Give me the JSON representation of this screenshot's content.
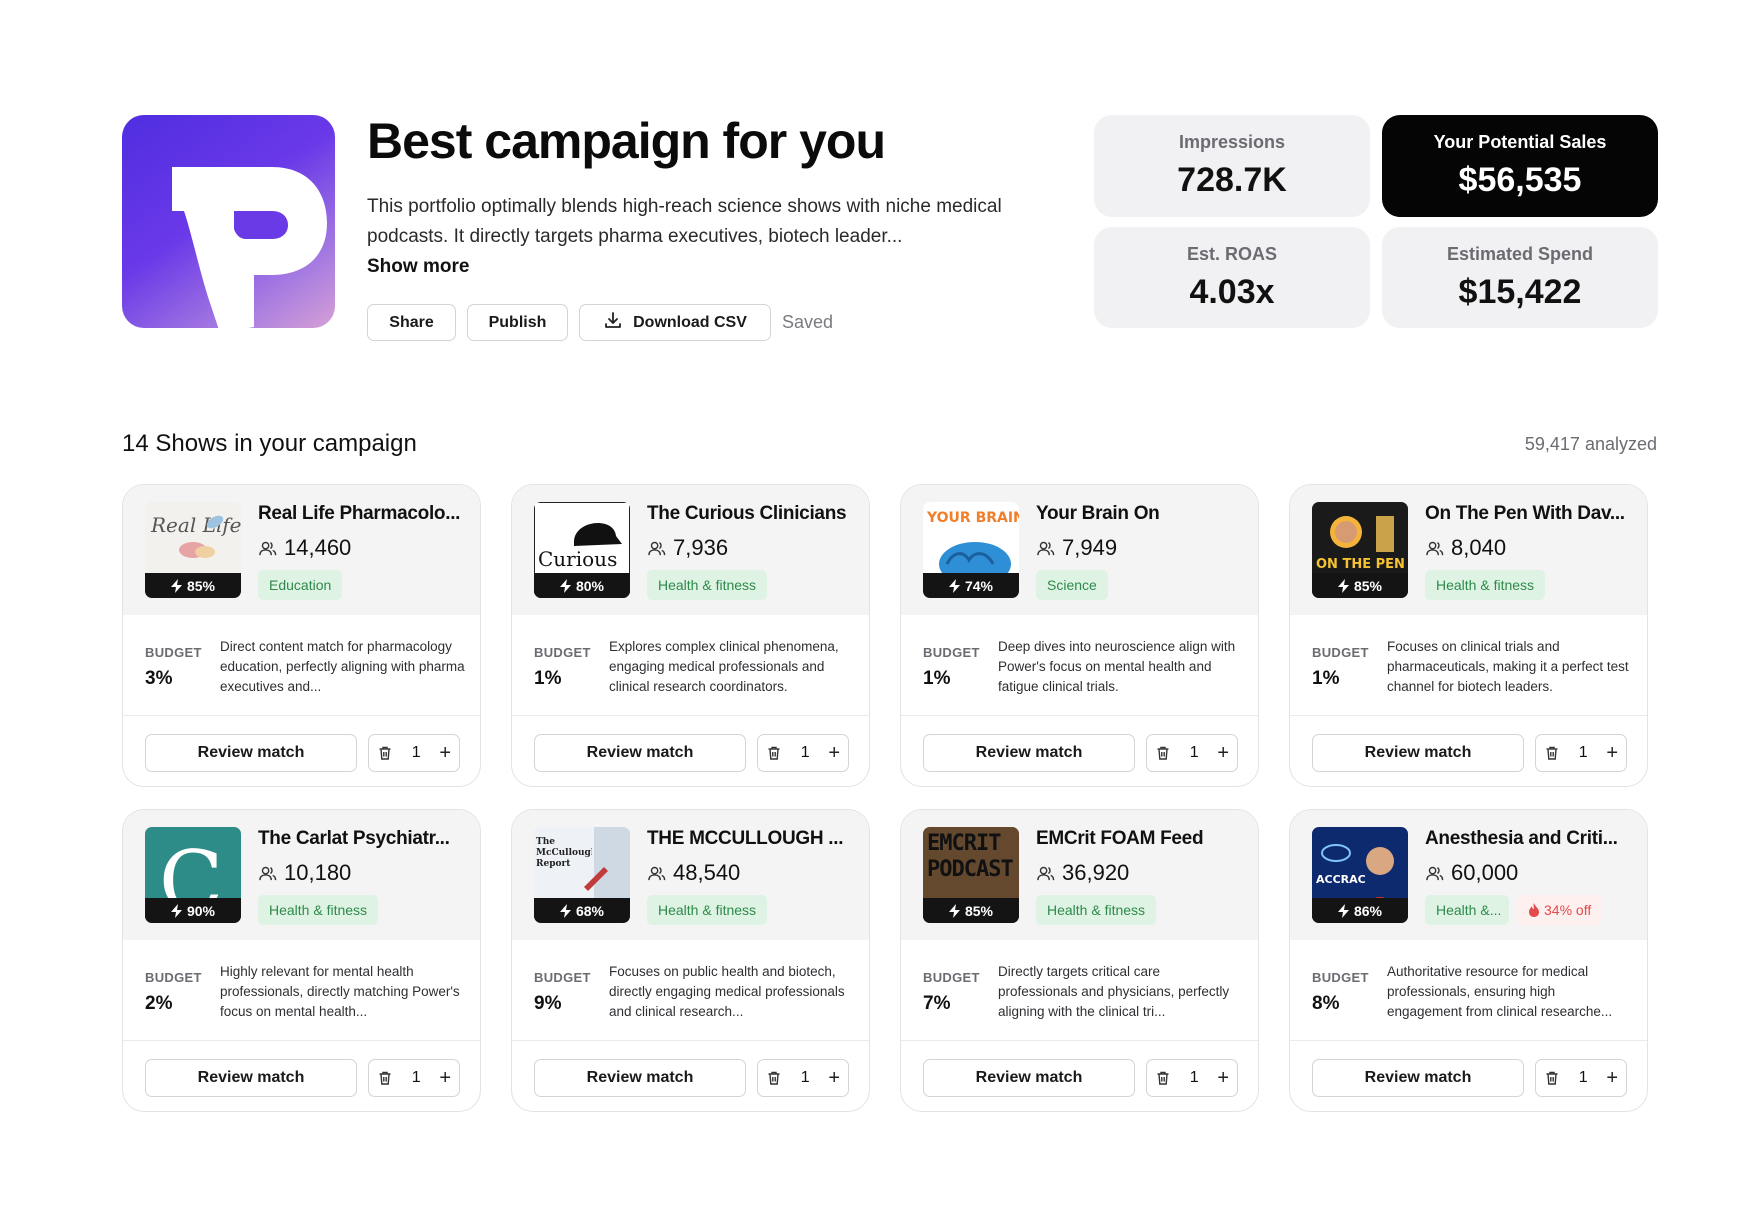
{
  "header": {
    "title": "Best campaign for you",
    "description": "This portfolio optimally blends high-reach science shows with niche medical podcasts. It directly targets pharma executives, biotech leader...",
    "show_more": "Show more",
    "buttons": {
      "share": "Share",
      "publish": "Publish",
      "download_csv": "Download CSV"
    },
    "saved": "Saved",
    "logo_icon": "brand-p-logo"
  },
  "stats": {
    "impressions": {
      "label": "Impressions",
      "value": "728.7K"
    },
    "potential_sales": {
      "label": "Your Potential Sales",
      "value": "$56,535"
    },
    "roas": {
      "label": "Est. ROAS",
      "value": "4.03x"
    },
    "spend": {
      "label": "Estimated Spend",
      "value": "$15,422"
    }
  },
  "section": {
    "title": "14 Shows in your campaign",
    "analyzed": "59,417 analyzed"
  },
  "cards": [
    {
      "name": "Real Life Pharmacolo...",
      "audience": "14,460",
      "match": "85%",
      "tag": "Education",
      "budget_label": "BUDGET",
      "budget": "3%",
      "reason": "Direct content match for pharmacology education, perfectly aligning with pharma executives and...",
      "review": "Review match",
      "qty": "1",
      "thumb_text": "Real Life"
    },
    {
      "name": "The Curious Clinicians",
      "audience": "7,936",
      "match": "80%",
      "tag": "Health & fitness",
      "budget_label": "BUDGET",
      "budget": "1%",
      "reason": "Explores complex clinical phenomena, engaging medical professionals and clinical research coordinators.",
      "review": "Review match",
      "qty": "1",
      "thumb_text": "Curious"
    },
    {
      "name": "Your Brain On",
      "audience": "7,949",
      "match": "74%",
      "tag": "Science",
      "budget_label": "BUDGET",
      "budget": "1%",
      "reason": "Deep dives into neuroscience align with Power's focus on mental health and fatigue clinical trials.",
      "review": "Review match",
      "qty": "1",
      "thumb_text": "YOUR BRAIN ON..."
    },
    {
      "name": "On The Pen With Dav...",
      "audience": "8,040",
      "match": "85%",
      "tag": "Health & fitness",
      "budget_label": "BUDGET",
      "budget": "1%",
      "reason": "Focuses on clinical trials and pharmaceuticals, making it a perfect test channel for biotech leaders.",
      "review": "Review match",
      "qty": "1",
      "thumb_text": "ON THE PEN"
    },
    {
      "name": "The Carlat Psychiatr...",
      "audience": "10,180",
      "match": "90%",
      "tag": "Health & fitness",
      "budget_label": "BUDGET",
      "budget": "2%",
      "reason": "Highly relevant for mental health professionals, directly matching Power's focus on mental health...",
      "review": "Review match",
      "qty": "1",
      "thumb_text": "C"
    },
    {
      "name": "THE MCCULLOUGH ...",
      "audience": "48,540",
      "match": "68%",
      "tag": "Health & fitness",
      "budget_label": "BUDGET",
      "budget": "9%",
      "reason": "Focuses on public health and biotech, directly engaging medical professionals and clinical research...",
      "review": "Review match",
      "qty": "1",
      "thumb_text": "The McCullough Report"
    },
    {
      "name": "EMCrit FOAM Feed",
      "audience": "36,920",
      "match": "85%",
      "tag": "Health & fitness",
      "budget_label": "BUDGET",
      "budget": "7%",
      "reason": "Directly targets critical care professionals and physicians, perfectly aligning with the clinical tri...",
      "review": "Review match",
      "qty": "1",
      "thumb_text": "EMCRIT PODCAST"
    },
    {
      "name": "Anesthesia and Criti...",
      "audience": "60,000",
      "match": "86%",
      "tag": "Health &...",
      "discount": "34% off",
      "budget_label": "BUDGET",
      "budget": "8%",
      "reason": "Authoritative resource for medical professionals, ensuring high engagement from clinical researche...",
      "review": "Review match",
      "qty": "1",
      "thumb_text": "ACCRAC"
    }
  ],
  "colors": {
    "accent_tag_bg": "#dff3e4",
    "accent_tag_text": "#2e8a4a",
    "discount": "#e14b4b",
    "sales_bg": "#050505"
  },
  "icons": [
    "brand-p-logo",
    "download-icon",
    "bolt-icon",
    "users-icon",
    "trash-icon",
    "plus-icon",
    "flame-icon"
  ]
}
